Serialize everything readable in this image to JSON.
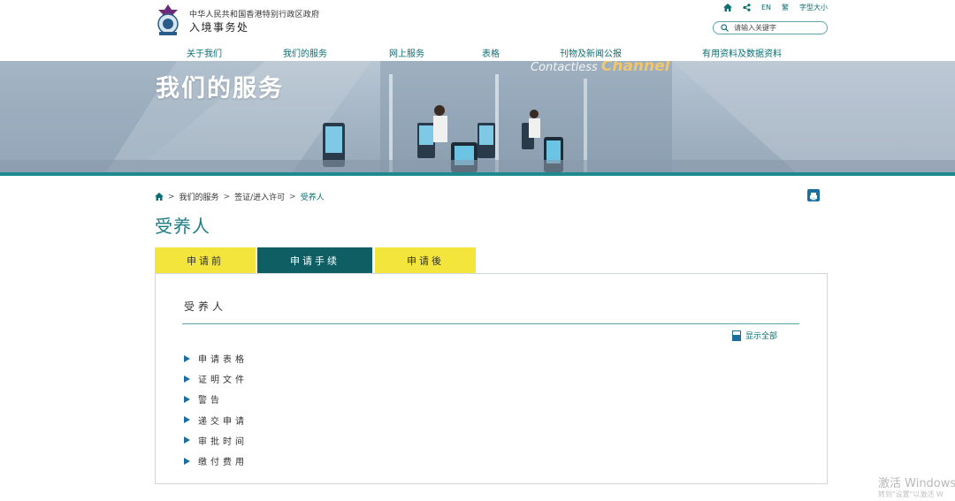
{
  "header": {
    "gov_name": "中华人民共和国香港特别行政区政府",
    "dept_name": "入境事务处",
    "utility": {
      "home_icon": "home-icon",
      "share_icon": "share-icon",
      "lang_en": "EN",
      "lang_trad": "繁",
      "font_size": "字型大小"
    },
    "search": {
      "placeholder": "请输入关键字",
      "icon": "search-icon"
    }
  },
  "nav": [
    {
      "label": "关于我们"
    },
    {
      "label": "我们的服务"
    },
    {
      "label": "网上服务"
    },
    {
      "label": "表格"
    },
    {
      "label": "刊物及新闻公报"
    },
    {
      "label": "有用资料及数据资料"
    }
  ],
  "banner": {
    "title": "我们的服务",
    "sign_text": "Contactless",
    "sign_brand": "Channel"
  },
  "breadcrumb": {
    "home_icon": "home-icon",
    "items": [
      "我们的服务",
      "签证/进入许可",
      "受养人"
    ]
  },
  "page_title": "受养人",
  "tabs": [
    {
      "label": "申请前",
      "active": false
    },
    {
      "label": "申请手续",
      "active": true
    },
    {
      "label": "申请後",
      "active": false
    }
  ],
  "panel": {
    "heading": "受养人",
    "show_all": "显示全部",
    "items": [
      "申请表格",
      "证明文件",
      "警告",
      "递交申请",
      "审批时间",
      "缴付费用"
    ]
  },
  "watermark": {
    "line1": "激活 Windows",
    "line2": "转到\"设置\"以激活 W"
  },
  "colors": {
    "teal": "#0b6e72",
    "tab_active": "#0f5e63",
    "tab_inactive": "#f3e53b",
    "accent_blue": "#1a6f9e"
  }
}
